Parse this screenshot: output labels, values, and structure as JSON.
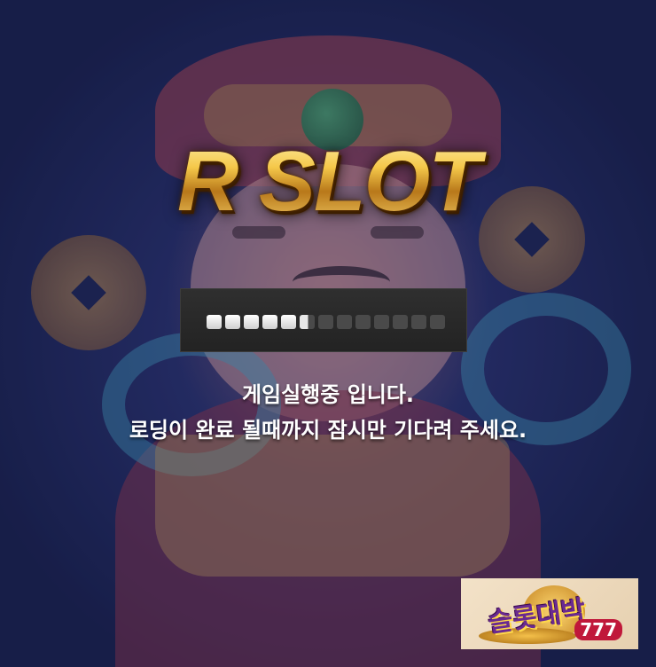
{
  "logo": {
    "text": "R SLOT"
  },
  "loader": {
    "total_segments": 13,
    "filled_segments": 5,
    "partial_fraction": 0.5
  },
  "message": {
    "line1": "게임실행중 입니다.",
    "line2": "로딩이 완료 될때까지 잠시만 기다려 주세요."
  },
  "corner_badge": {
    "icon": "slot-promo-banner"
  },
  "colors": {
    "logo_gold": "#d9a02b",
    "loader_bg": "#2a2a2a",
    "text": "#ffffff"
  }
}
